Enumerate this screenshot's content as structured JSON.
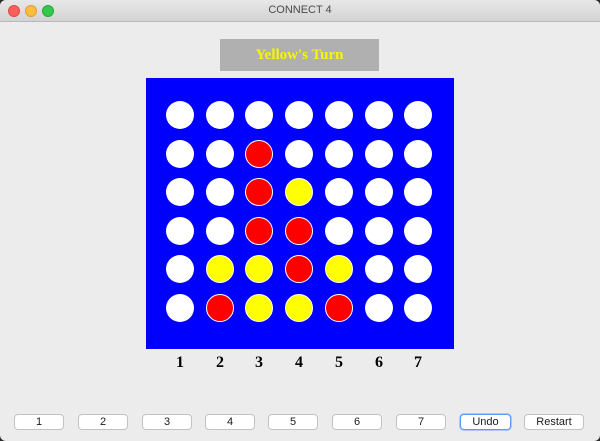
{
  "window": {
    "title": "CONNECT 4"
  },
  "status": {
    "turn_text": "Yellow's Turn"
  },
  "board": {
    "rows": 6,
    "columns": 7,
    "cells": [
      [
        "empty",
        "empty",
        "empty",
        "empty",
        "empty",
        "empty",
        "empty"
      ],
      [
        "empty",
        "empty",
        "red",
        "empty",
        "empty",
        "empty",
        "empty"
      ],
      [
        "empty",
        "empty",
        "red",
        "yellow",
        "empty",
        "empty",
        "empty"
      ],
      [
        "empty",
        "empty",
        "red",
        "red",
        "empty",
        "empty",
        "empty"
      ],
      [
        "empty",
        "yellow",
        "yellow",
        "red",
        "yellow",
        "empty",
        "empty"
      ],
      [
        "empty",
        "red",
        "yellow",
        "yellow",
        "red",
        "empty",
        "empty"
      ]
    ],
    "colors": {
      "board": "#0000ff",
      "empty": "#ffffff",
      "red": "#ff0000",
      "yellow": "#ffff00"
    }
  },
  "column_labels": [
    "1",
    "2",
    "3",
    "4",
    "5",
    "6",
    "7"
  ],
  "controls": {
    "column_buttons": [
      "1",
      "2",
      "3",
      "4",
      "5",
      "6",
      "7"
    ],
    "undo_label": "Undo",
    "restart_label": "Restart"
  }
}
